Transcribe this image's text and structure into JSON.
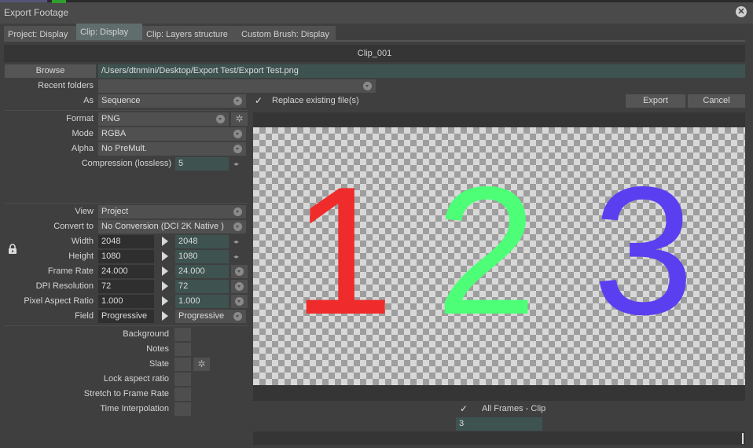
{
  "window": {
    "title": "Export Footage",
    "close_glyph": "✕"
  },
  "tabs": [
    {
      "label": "Project: Display",
      "active": false
    },
    {
      "label": "Clip: Display",
      "active": true
    },
    {
      "label": "Clip: Layers structure",
      "active": false
    },
    {
      "label": "Custom Brush: Display",
      "active": false
    }
  ],
  "clip_name": "Clip_001",
  "browse": {
    "label": "Browse",
    "path": "/Users/dtnmini/Desktop/Export Test/Export Test.png"
  },
  "recent_folders": {
    "label": "Recent folders",
    "value": ""
  },
  "as": {
    "label": "As",
    "value": "Sequence"
  },
  "replace": {
    "checked": true,
    "check_glyph": "✓",
    "label": "Replace existing file(s)"
  },
  "actions": {
    "export_label": "Export",
    "cancel_label": "Cancel"
  },
  "format": {
    "label": "Format",
    "value": "PNG"
  },
  "mode": {
    "label": "Mode",
    "value": "RGBA"
  },
  "alpha": {
    "label": "Alpha",
    "value": "No PreMult."
  },
  "compression": {
    "label": "Compression (lossless)",
    "value": "5"
  },
  "view": {
    "label": "View",
    "value": "Project"
  },
  "convert_to": {
    "label": "Convert to",
    "value": "No Conversion (DCI 2K Native  )"
  },
  "dimensions": [
    {
      "label": "Width",
      "source": "2048",
      "target": "2048",
      "control": "spin"
    },
    {
      "label": "Height",
      "source": "1080",
      "target": "1080",
      "control": "spin"
    },
    {
      "label": "Frame Rate",
      "source": "24.000",
      "target": "24.000",
      "control": "dropdown"
    },
    {
      "label": "DPI Resolution",
      "source": "72",
      "target": "72",
      "control": "dropdown"
    },
    {
      "label": "Pixel Aspect Ratio",
      "source": "1.000",
      "target": "1.000",
      "control": "dropdown"
    },
    {
      "label": "Field",
      "source": "Progressive",
      "target": "Progressive",
      "control": "dropdown"
    }
  ],
  "options": [
    {
      "label": "Background",
      "checked": false
    },
    {
      "label": "Notes",
      "checked": false
    },
    {
      "label": "Slate",
      "checked": false,
      "has_settings": true
    },
    {
      "label": "Lock aspect ratio",
      "checked": false
    },
    {
      "label": "Stretch to Frame Rate",
      "checked": false
    },
    {
      "label": "Time Interpolation",
      "checked": false
    }
  ],
  "preview": {
    "digits": [
      {
        "text": "1",
        "color": "#ef2b2b"
      },
      {
        "text": "2",
        "color": "#4dff77"
      },
      {
        "text": "3",
        "color": "#5a3ff0"
      }
    ]
  },
  "frames": {
    "checked": true,
    "check_glyph": "✓",
    "label": "All Frames - Clip",
    "value": "3"
  },
  "icons": {
    "lock": "lock-icon",
    "wand": "magic-wand-icon",
    "arrow": "play-arrow-icon",
    "spin": "spin-arrows-icon"
  }
}
